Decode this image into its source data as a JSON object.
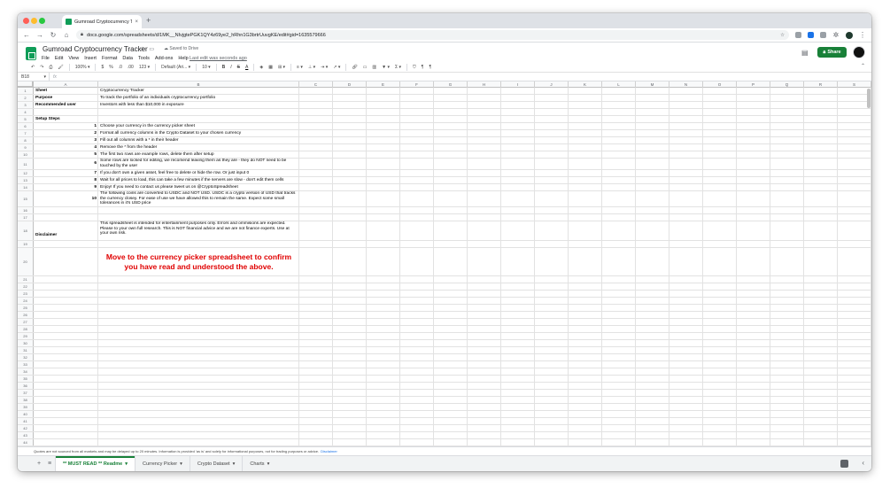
{
  "browser": {
    "tab_title": "Gumroad Cryptocurrency Trac",
    "tab_close": "×",
    "new_tab": "+",
    "url": "docs.google.com/spreadsheets/d/1MK__NIvjgtePGK1QY4z69ye2_hRhn1G3brtrUuvgKE/edit#gid=1635579666"
  },
  "doc": {
    "title": "Gumroad Cryptocurrency Tracker",
    "saved": "Saved to Drive",
    "menu": [
      "File",
      "Edit",
      "View",
      "Insert",
      "Format",
      "Data",
      "Tools",
      "Add-ons",
      "Help"
    ],
    "last_edit": "Last edit was seconds ago",
    "share": "Share"
  },
  "toolbar": {
    "zoom": "100%",
    "currency": "$",
    "percent": "%",
    "dec_less": ".0",
    "dec_more": ".00",
    "num_fmt": "123",
    "font": "Default (Ari...",
    "font_size": "10",
    "bold": "B",
    "italic": "I",
    "strike": "S",
    "text_color": "A",
    "sigma": "Σ"
  },
  "formula_bar": {
    "cell_ref": "B18",
    "fx": "fx"
  },
  "columns": [
    "A",
    "B",
    "C",
    "D",
    "E",
    "F",
    "G",
    "H",
    "I",
    "J",
    "K",
    "L",
    "M",
    "N",
    "O",
    "P",
    "Q",
    "R",
    "S"
  ],
  "rows": [
    {
      "n": "1",
      "a": "Sheet",
      "b": "Cryptocurrency Tracker"
    },
    {
      "n": "2",
      "a": "Purpose",
      "b": "To track the portfolio of an individuals cryptocurrency portfolio"
    },
    {
      "n": "3",
      "a": "Recommended user",
      "b": "Investors with less than $10,000 in exposure"
    },
    {
      "n": "4",
      "a": "",
      "b": ""
    },
    {
      "n": "5",
      "a": "Setup Steps",
      "b": ""
    },
    {
      "n": "6",
      "a": "1",
      "b": "Choose your currency in the currency picker sheet"
    },
    {
      "n": "7",
      "a": "2",
      "b": "Format all currency columns in the Crypto Dataset to your chosen currency"
    },
    {
      "n": "8",
      "a": "3",
      "b": "Fill out all columns with a * in their header"
    },
    {
      "n": "9",
      "a": "4",
      "b": "Remove the * from the header"
    },
    {
      "n": "10",
      "a": "5",
      "b": "The first two rows are example rows, delete them after setup"
    },
    {
      "n": "11",
      "a": "6",
      "b": "Some rows are locked for editing, we recomend leaving them as they are - they do NOT need to be touched by the user"
    },
    {
      "n": "12",
      "a": "7",
      "b": "If you don't own a given asset, feel free to delete or hide the row. Or just input 0"
    },
    {
      "n": "13",
      "a": "8",
      "b": "Wait for all prices to load, this can take a few minutes if the servers are slow - don't edit them cells"
    },
    {
      "n": "14",
      "a": "9",
      "b": "Enjoy! If you need to contact us please tweet us on @CryptoSpreadsheet"
    },
    {
      "n": "15",
      "a": "10",
      "b": "The following coins are converted to USDC and NOT USD. USDC is a crypto version of USD that tracks the currency closey. For ease of use we have allowed this to remain the same. Expect some small tolerances in it's USD price"
    },
    {
      "n": "16",
      "a": "",
      "b": ""
    },
    {
      "n": "17",
      "a": "",
      "b": ""
    },
    {
      "n": "18",
      "a": "Disclaimer",
      "b": "This spreadsheet is intended for entertainment purposes only. Errors and ommisions are expected. Please to your own full research. This is NOT financial advice and we are not finance experts. Use at your own risk."
    },
    {
      "n": "19",
      "a": "",
      "b": ""
    },
    {
      "n": "20",
      "a": "",
      "b": "Move to the currency picker spreadsheet to confirm you have read and understood the above."
    }
  ],
  "empty_rows": [
    "21",
    "22",
    "23",
    "24",
    "25",
    "26",
    "27",
    "28",
    "29",
    "30",
    "31",
    "32",
    "33",
    "34",
    "35",
    "36",
    "37",
    "38",
    "39",
    "40",
    "41",
    "42",
    "43",
    "44",
    "45"
  ],
  "footnote": {
    "text": "Quotes are not sourced from all markets and may be delayed up to 20 minutes. Information is provided 'as is' and solely for informational purposes, not for trading purposes or advice.",
    "link": "Disclaimer"
  },
  "sheet_tabs": [
    {
      "label": "** MUST READ ** Readme",
      "active": true
    },
    {
      "label": "Currency Picker",
      "active": false
    },
    {
      "label": "Crypto Dataset",
      "active": false
    },
    {
      "label": "Charts",
      "active": false
    }
  ],
  "colors": {
    "accent": "#188038",
    "warning": "#e00000",
    "link": "#1a73e8"
  }
}
